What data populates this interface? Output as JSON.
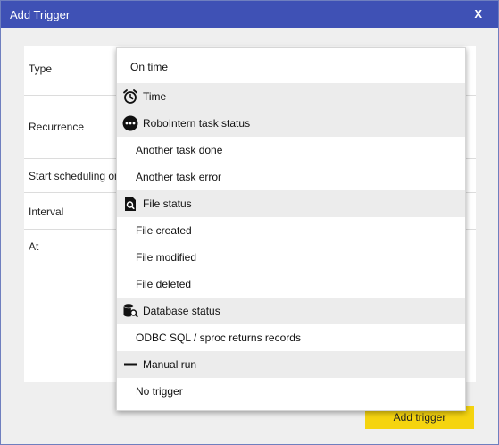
{
  "window": {
    "title": "Add Trigger",
    "close_label": "X"
  },
  "form": {
    "rows": [
      {
        "label": "Type"
      },
      {
        "label": "Recurrence"
      },
      {
        "label": "Start scheduling on"
      },
      {
        "label": "Interval"
      },
      {
        "label": "At"
      }
    ],
    "submit_label": "Add trigger",
    "submit_color": "#f5d40f"
  },
  "titlebar_color": "#3f51b5",
  "dropdown": {
    "items": [
      {
        "label": "On time",
        "kind": "option"
      },
      {
        "label": "Time",
        "kind": "group",
        "icon": "alarm-clock-icon"
      },
      {
        "label": "RoboIntern task status",
        "kind": "group",
        "icon": "more-dots-icon"
      },
      {
        "label": "Another task done",
        "kind": "option"
      },
      {
        "label": "Another task error",
        "kind": "option"
      },
      {
        "label": "File status",
        "kind": "group",
        "icon": "file-search-icon"
      },
      {
        "label": "File created",
        "kind": "option"
      },
      {
        "label": "File modified",
        "kind": "option"
      },
      {
        "label": "File deleted",
        "kind": "option"
      },
      {
        "label": "Database status",
        "kind": "group",
        "icon": "database-search-icon"
      },
      {
        "label": "ODBC SQL / sproc returns records",
        "kind": "option"
      },
      {
        "label": "Manual run",
        "kind": "group",
        "icon": "minus-icon"
      },
      {
        "label": "No trigger",
        "kind": "option"
      }
    ]
  }
}
